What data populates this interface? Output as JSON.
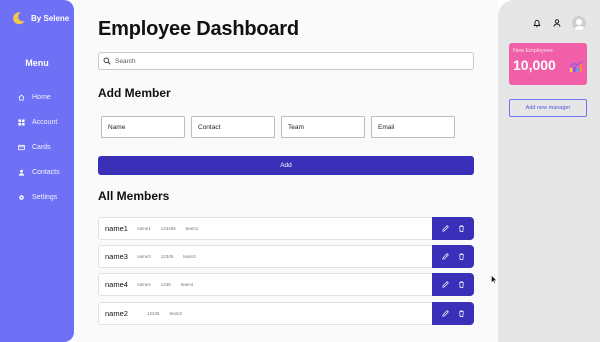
{
  "brand": {
    "name": "By Selene"
  },
  "sidebar": {
    "menu_title": "Menu",
    "items": [
      {
        "label": "Home",
        "icon": "home-icon"
      },
      {
        "label": "Account",
        "icon": "grid-icon"
      },
      {
        "label": "Cards",
        "icon": "card-icon"
      },
      {
        "label": "Contacts",
        "icon": "user-icon"
      },
      {
        "label": "Settings",
        "icon": "gear-icon"
      }
    ]
  },
  "main": {
    "title": "Employee Dashboard",
    "search": {
      "placeholder": "Search",
      "value": ""
    },
    "add_member": {
      "title": "Add Member",
      "fields": [
        {
          "placeholder": "Name"
        },
        {
          "placeholder": "Contact"
        },
        {
          "placeholder": "Team"
        },
        {
          "placeholder": "Email"
        }
      ],
      "button_label": "Add"
    },
    "all_members": {
      "title": "All Members",
      "rows": [
        {
          "name": "name1",
          "email": "name1",
          "contact": "123456",
          "team": "team1"
        },
        {
          "name": "name3",
          "email": "name3",
          "contact": "12345",
          "team": "team3"
        },
        {
          "name": "name4",
          "email": "name4",
          "contact": "1236",
          "team": "team4"
        },
        {
          "name": "name2",
          "email": "",
          "contact": "12345",
          "team": "team2"
        }
      ]
    }
  },
  "right_panel": {
    "icons": [
      "bell-icon",
      "user-icon",
      "avatar"
    ],
    "stat": {
      "label": "New Employees",
      "value": "10,000"
    },
    "manager_button": "Add new manager"
  },
  "colors": {
    "sidebar": "#6e71f5",
    "primary": "#3a2fb8",
    "stat_card": "#f05fa8",
    "right_panel": "#e6e6e6"
  }
}
